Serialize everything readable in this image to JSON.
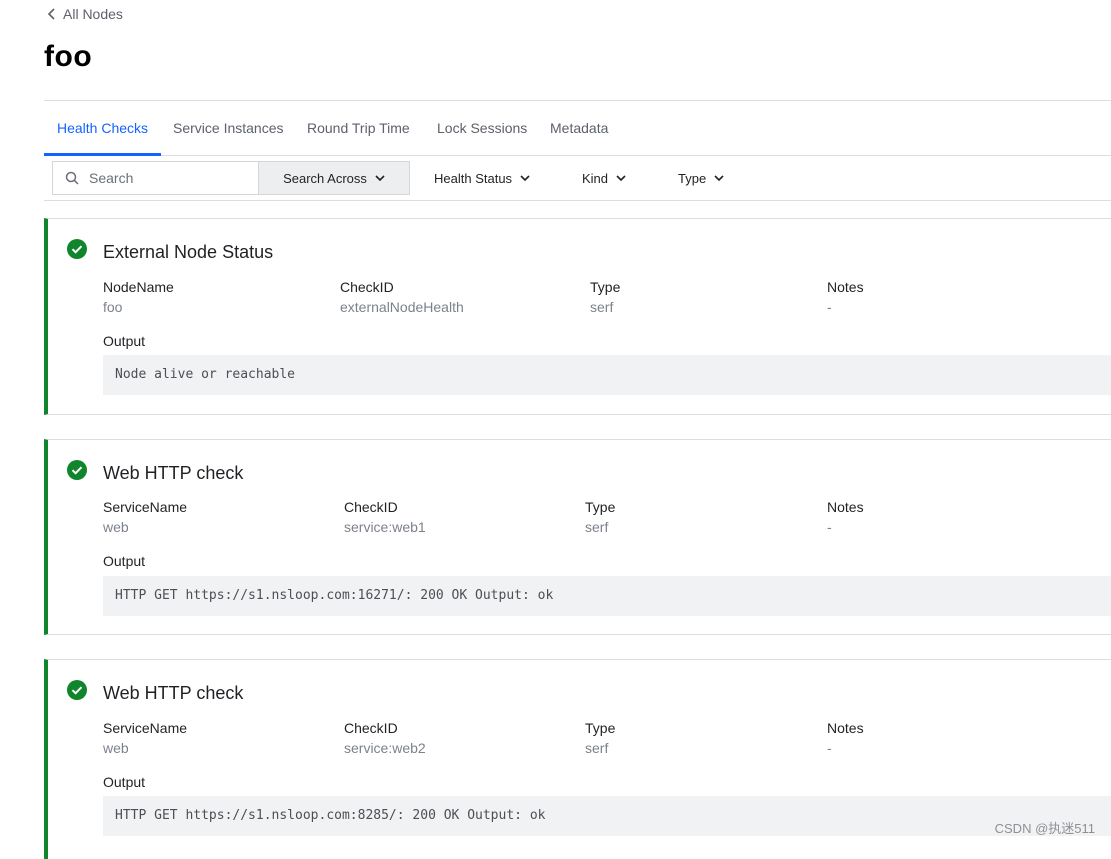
{
  "nav": {
    "back_label": "All Nodes"
  },
  "page": {
    "title": "foo"
  },
  "tabs": [
    {
      "label": "Health Checks",
      "active": true
    },
    {
      "label": "Service Instances",
      "active": false
    },
    {
      "label": "Round Trip Time",
      "active": false
    },
    {
      "label": "Lock Sessions",
      "active": false
    },
    {
      "label": "Metadata",
      "active": false
    }
  ],
  "toolbar": {
    "search_placeholder": "Search",
    "search_across_label": "Search Across",
    "filters": [
      {
        "label": "Health Status"
      },
      {
        "label": "Kind"
      },
      {
        "label": "Type"
      }
    ]
  },
  "checks": [
    {
      "status": "passing",
      "title": "External Node Status",
      "fields": [
        {
          "label": "NodeName",
          "value": "foo"
        },
        {
          "label": "CheckID",
          "value": "externalNodeHealth"
        },
        {
          "label": "Type",
          "value": "serf"
        },
        {
          "label": "Notes",
          "value": "-"
        }
      ],
      "output_label": "Output",
      "output": "Node alive or reachable"
    },
    {
      "status": "passing",
      "title": "Web HTTP check",
      "fields": [
        {
          "label": "ServiceName",
          "value": "web"
        },
        {
          "label": "CheckID",
          "value": "service:web1"
        },
        {
          "label": "Type",
          "value": "serf"
        },
        {
          "label": "Notes",
          "value": "-"
        }
      ],
      "output_label": "Output",
      "output": "HTTP GET https://s1.nsloop.com:16271/: 200 OK Output: ok"
    },
    {
      "status": "passing",
      "title": "Web HTTP check",
      "fields": [
        {
          "label": "ServiceName",
          "value": "web"
        },
        {
          "label": "CheckID",
          "value": "service:web2"
        },
        {
          "label": "Type",
          "value": "serf"
        },
        {
          "label": "Notes",
          "value": "-"
        }
      ],
      "output_label": "Output",
      "output": "HTTP GET https://s1.nsloop.com:8285/: 200 OK Output: ok"
    }
  ],
  "colors": {
    "accent": "#1563ff",
    "passing": "#10852c"
  },
  "watermark": "CSDN @执迷511"
}
